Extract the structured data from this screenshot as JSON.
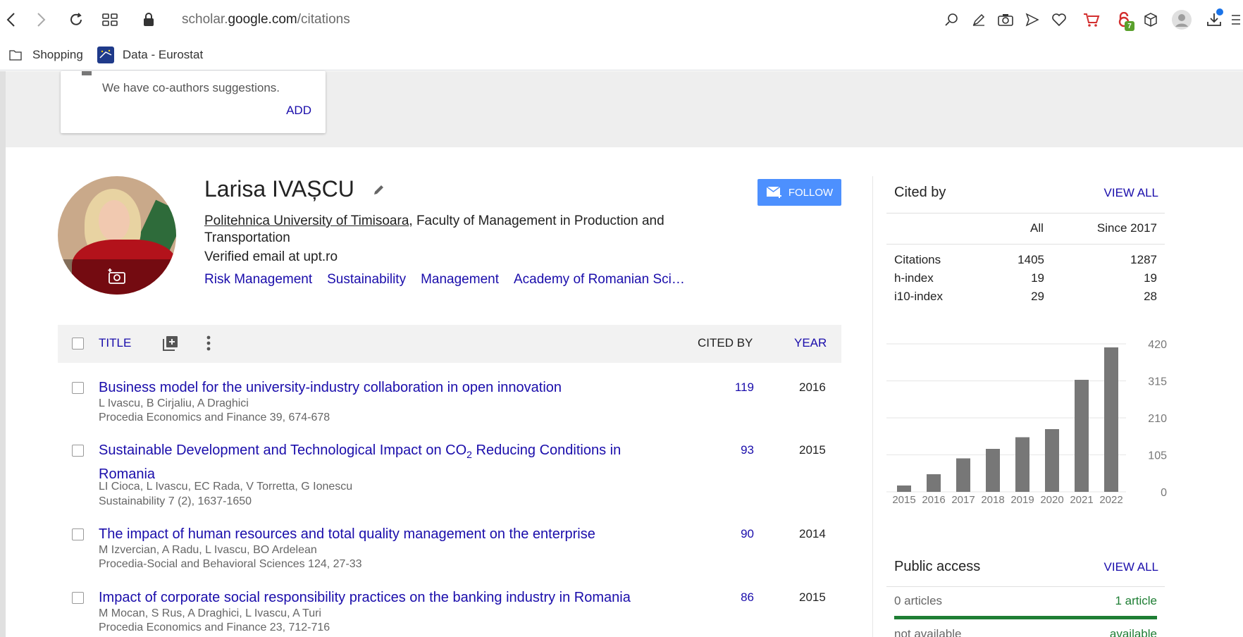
{
  "browser": {
    "url_domain": "scholar.",
    "url_host": "google.com",
    "url_path": "/citations",
    "bookmarks": [
      {
        "label": "Shopping",
        "icon": "folder-icon"
      },
      {
        "label": "Data - Eurostat",
        "icon": "eurostat-icon"
      }
    ],
    "badge_count": "7"
  },
  "suggestion": {
    "text": "We have co-authors suggestions.",
    "add_label": "ADD"
  },
  "profile": {
    "name": "Larisa IVAȘCU",
    "university": "Politehnica University of Timisoara",
    "affiliation_rest": ", Faculty of Management in Production and Transportation",
    "email": "Verified email at upt.ro",
    "interests": [
      "Risk Management",
      "Sustainability",
      "Management",
      "Academy of Romanian Sci…"
    ],
    "follow_label": "FOLLOW"
  },
  "table": {
    "title_label": "TITLE",
    "cited_by_label": "CITED BY",
    "year_label": "YEAR"
  },
  "articles": [
    {
      "title": "Business model for the university-industry collaboration in open innovation",
      "authors": "L Ivascu, B Cirjaliu, A Draghici",
      "publication": "Procedia Economics and Finance 39, 674-678",
      "cited_by": "119",
      "year": "2016"
    },
    {
      "title_pre": "Sustainable Development and Technological Impact on CO",
      "title_sub": "2",
      "title_post": " Reducing Conditions in Romania",
      "authors": "LI Cioca, L Ivascu, EC Rada, V Torretta, G Ionescu",
      "publication": "Sustainability 7 (2), 1637-1650",
      "cited_by": "93",
      "year": "2015"
    },
    {
      "title": "The impact of human resources and total quality management on the enterprise",
      "authors": "M Izvercian, A Radu, L Ivascu, BO Ardelean",
      "publication": "Procedia-Social and Behavioral Sciences 124, 27-33",
      "cited_by": "90",
      "year": "2014"
    },
    {
      "title": "Impact of corporate social responsibility practices on the banking industry in Romania",
      "authors": "M Mocan, S Rus, A Draghici, L Ivascu, A Turi",
      "publication": "Procedia Economics and Finance 23, 712-716",
      "cited_by": "86",
      "year": "2015"
    }
  ],
  "cited_by": {
    "title": "Cited by",
    "view_all": "VIEW ALL",
    "col_all": "All",
    "col_since": "Since 2017",
    "rows": [
      {
        "label": "Citations",
        "all": "1405",
        "since": "1287"
      },
      {
        "label": "h-index",
        "all": "19",
        "since": "19"
      },
      {
        "label": "i10-index",
        "all": "29",
        "since": "28"
      }
    ]
  },
  "chart_data": {
    "type": "bar",
    "categories": [
      "2015",
      "2016",
      "2017",
      "2018",
      "2019",
      "2020",
      "2021",
      "2022"
    ],
    "values": [
      18,
      50,
      95,
      122,
      155,
      178,
      318,
      410
    ],
    "ylim": [
      0,
      420
    ],
    "yticks": [
      "0",
      "105",
      "210",
      "315",
      "420"
    ],
    "grid": true,
    "bar_color": "#777777"
  },
  "public_access": {
    "title": "Public access",
    "view_all": "VIEW ALL",
    "left": "0 articles",
    "right": "1 article",
    "left2": "not available",
    "right2": "available",
    "available_fraction": 1.0
  }
}
